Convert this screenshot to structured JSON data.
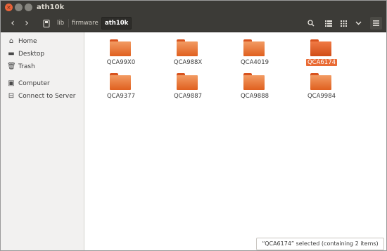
{
  "window": {
    "title": "ath10k",
    "buttons": {
      "close": "×",
      "minimize": "",
      "maximize": ""
    }
  },
  "toolbar": {
    "back_icon": "‹",
    "forward_icon": "›",
    "breadcrumbs": [
      {
        "label": "lib"
      },
      {
        "label": "firmware"
      },
      {
        "label": "ath10k",
        "active": true
      }
    ],
    "search_icon": "⌕",
    "list_view_icon": "≣",
    "grid_view_icon": "⠿",
    "menu_icon": "˅",
    "app_menu_icon": "≡"
  },
  "sidebar": {
    "items": [
      {
        "label": "Home",
        "icon": "home-icon",
        "glyph": "⌂"
      },
      {
        "label": "Desktop",
        "icon": "desktop-icon",
        "glyph": "▬"
      },
      {
        "label": "Trash",
        "icon": "trash-icon",
        "glyph": "🗑"
      },
      {
        "label": "Computer",
        "icon": "computer-icon",
        "glyph": "▣"
      },
      {
        "label": "Connect to Server",
        "icon": "server-icon",
        "glyph": "⊟"
      }
    ]
  },
  "files": [
    {
      "name": "QCA99X0"
    },
    {
      "name": "QCA988X"
    },
    {
      "name": "QCA4019"
    },
    {
      "name": "QCA6174",
      "selected": true
    },
    {
      "name": "QCA9377"
    },
    {
      "name": "QCA9887"
    },
    {
      "name": "QCA9888"
    },
    {
      "name": "QCA9984"
    }
  ],
  "status": {
    "text": "“QCA6174” selected (containing 2 items)"
  },
  "colors": {
    "accent": "#e96a34",
    "folder": "#f0803f",
    "titlebar": "#3c3b37"
  }
}
